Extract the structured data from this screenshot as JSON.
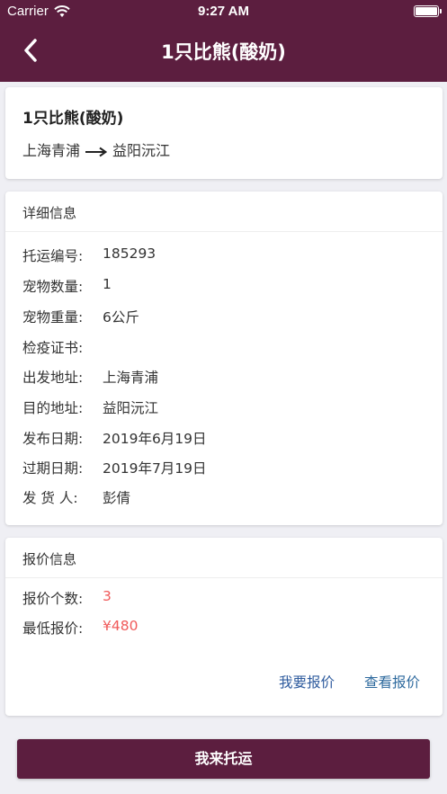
{
  "status_bar": {
    "carrier": "Carrier",
    "time": "9:27 AM"
  },
  "nav": {
    "title": "1只比熊(酸奶)"
  },
  "summary": {
    "title": "1只比熊(酸奶)",
    "from": "上海青浦",
    "to": "益阳沅江"
  },
  "detail": {
    "header": "详细信息",
    "rows": [
      {
        "label": "托运编号:",
        "value": "185293"
      },
      {
        "label": "宠物数量:",
        "value": "1"
      },
      {
        "label": "宠物重量:",
        "value": "6公斤"
      },
      {
        "label": "检疫证书:",
        "value": ""
      },
      {
        "label": "出发地址:",
        "value": "上海青浦"
      },
      {
        "label": "目的地址:",
        "value": "益阳沅江"
      },
      {
        "label": "发布日期:",
        "value": "2019年6月19日"
      },
      {
        "label": "过期日期:",
        "value": "2019年7月19日"
      },
      {
        "label": "发 货 人:",
        "value": "彭倩"
      }
    ]
  },
  "quote": {
    "header": "报价信息",
    "rows": [
      {
        "label": "报价个数:",
        "value": "3"
      },
      {
        "label": "最低报价:",
        "value": "¥480"
      }
    ],
    "make_offer_label": "我要报价",
    "view_offers_label": "查看报价"
  },
  "actions": {
    "ship_label": "我来托运"
  },
  "colors": {
    "primary": "#5c1e3f",
    "accent_red": "#f05a5a",
    "link_blue": "#2e5b9e",
    "background": "#efeff4"
  }
}
